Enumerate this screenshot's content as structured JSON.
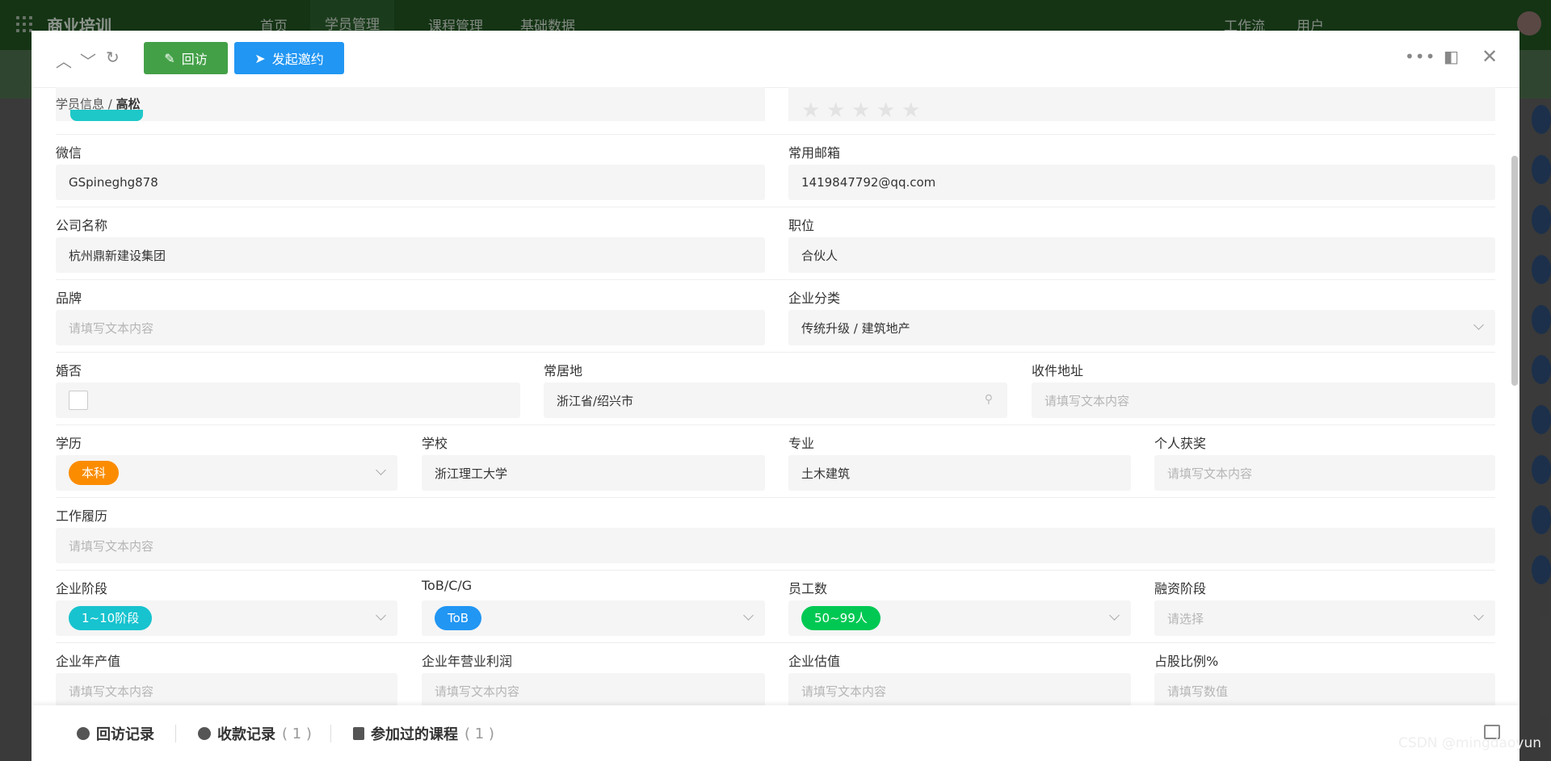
{
  "app": {
    "brand": "商业培训",
    "nav": [
      "首页",
      "学员管理",
      "课程管理",
      "基础数据"
    ],
    "right_nav": [
      "工作流",
      "用户"
    ]
  },
  "header": {
    "revisit_label": "回访",
    "invite_label": "发起邀约"
  },
  "breadcrumb": {
    "parent": "学员信息",
    "separator": "/",
    "current": "高松"
  },
  "form": {
    "wechat": {
      "label": "微信",
      "value": "GSpineghg878"
    },
    "email": {
      "label": "常用邮箱",
      "value": "1419847792@qq.com"
    },
    "company": {
      "label": "公司名称",
      "value": "杭州鼎新建设集团"
    },
    "position": {
      "label": "职位",
      "value": "合伙人"
    },
    "brand": {
      "label": "品牌",
      "placeholder": "请填写文本内容"
    },
    "industry": {
      "label": "企业分类",
      "value": "传统升级 / 建筑地产"
    },
    "married": {
      "label": "婚否"
    },
    "residence": {
      "label": "常居地",
      "value": "浙江省/绍兴市"
    },
    "address": {
      "label": "收件地址",
      "placeholder": "请填写文本内容"
    },
    "education": {
      "label": "学历",
      "value": "本科"
    },
    "school": {
      "label": "学校",
      "value": "浙江理工大学"
    },
    "major": {
      "label": "专业",
      "value": "土木建筑"
    },
    "awards": {
      "label": "个人获奖",
      "placeholder": "请填写文本内容"
    },
    "resume": {
      "label": "工作履历",
      "placeholder": "请填写文本内容"
    },
    "stage": {
      "label": "企业阶段",
      "value": "1~10阶段"
    },
    "tob": {
      "label": "ToB/C/G",
      "value": "ToB"
    },
    "employees": {
      "label": "员工数",
      "value": "50~99人"
    },
    "financing": {
      "label": "融资阶段",
      "placeholder": "请选择"
    },
    "output": {
      "label": "企业年产值",
      "placeholder": "请填写文本内容"
    },
    "profit": {
      "label": "企业年营业利润",
      "placeholder": "请填写文本内容"
    },
    "valuation": {
      "label": "企业估值",
      "placeholder": "请填写文本内容"
    },
    "equity": {
      "label": "占股比例%",
      "placeholder": "请填写数值"
    }
  },
  "tabs": {
    "revisit": {
      "label": "回访记录"
    },
    "payments": {
      "label": "收款记录",
      "count": "( 1 )"
    },
    "courses": {
      "label": "参加过的课程",
      "count": "( 1 )"
    }
  },
  "watermark": "CSDN @mingdaoyun",
  "colors": {
    "green": "#43a047",
    "blue": "#2196f3",
    "orange": "#fb8c00",
    "teal": "#17c3cf",
    "tag_green": "#00c853"
  }
}
